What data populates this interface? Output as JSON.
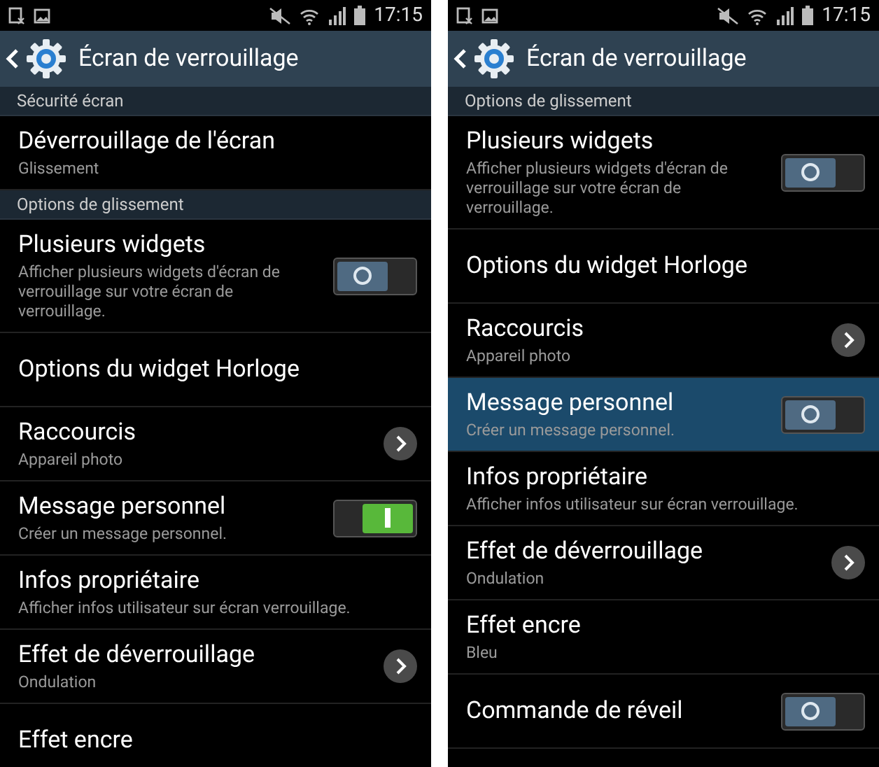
{
  "screens": [
    {
      "status_bar": {
        "time": "17:15"
      },
      "title": "Écran de verrouillage",
      "items": [
        {
          "kind": "header",
          "label": "Sécurité écran"
        },
        {
          "kind": "plain",
          "label": "Déverrouillage de l'écran",
          "subtitle": "Glissement",
          "selected": false
        },
        {
          "kind": "header",
          "label": "Options de glissement"
        },
        {
          "kind": "toggle",
          "label": "Plusieurs widgets",
          "subtitle": "Afficher plusieurs widgets d'écran de verrouillage sur votre écran de verrouillage.",
          "on": false,
          "selected": false
        },
        {
          "kind": "plain",
          "label": "Options du widget Horloge",
          "selected": false
        },
        {
          "kind": "chevron",
          "label": "Raccourcis",
          "subtitle": "Appareil photo",
          "selected": false
        },
        {
          "kind": "toggle",
          "label": "Message personnel",
          "subtitle": "Créer un message personnel.",
          "on": true,
          "selected": false
        },
        {
          "kind": "plain",
          "label": "Infos propriétaire",
          "subtitle": "Afficher infos utilisateur sur écran verrouillage.",
          "selected": false
        },
        {
          "kind": "chevron",
          "label": "Effet de déverrouillage",
          "subtitle": "Ondulation",
          "selected": false
        },
        {
          "kind": "plain",
          "label": "Effet encre",
          "selected": false
        }
      ]
    },
    {
      "status_bar": {
        "time": "17:15"
      },
      "title": "Écran de verrouillage",
      "items": [
        {
          "kind": "header",
          "label": "Options de glissement"
        },
        {
          "kind": "toggle",
          "label": "Plusieurs widgets",
          "subtitle": "Afficher plusieurs widgets d'écran de verrouillage sur votre écran de verrouillage.",
          "on": false,
          "selected": false
        },
        {
          "kind": "plain",
          "label": "Options du widget Horloge",
          "selected": false
        },
        {
          "kind": "chevron",
          "label": "Raccourcis",
          "subtitle": "Appareil photo",
          "selected": false
        },
        {
          "kind": "toggle",
          "label": "Message personnel",
          "subtitle": "Créer un message personnel.",
          "on": false,
          "selected": true
        },
        {
          "kind": "plain",
          "label": "Infos propriétaire",
          "subtitle": "Afficher infos utilisateur sur écran verrouillage.",
          "selected": false
        },
        {
          "kind": "chevron",
          "label": "Effet de déverrouillage",
          "subtitle": "Ondulation",
          "selected": false
        },
        {
          "kind": "plain",
          "label": "Effet encre",
          "subtitle": "Bleu",
          "selected": false
        },
        {
          "kind": "toggle",
          "label": "Commande de réveil",
          "on": false,
          "selected": false
        }
      ]
    }
  ]
}
